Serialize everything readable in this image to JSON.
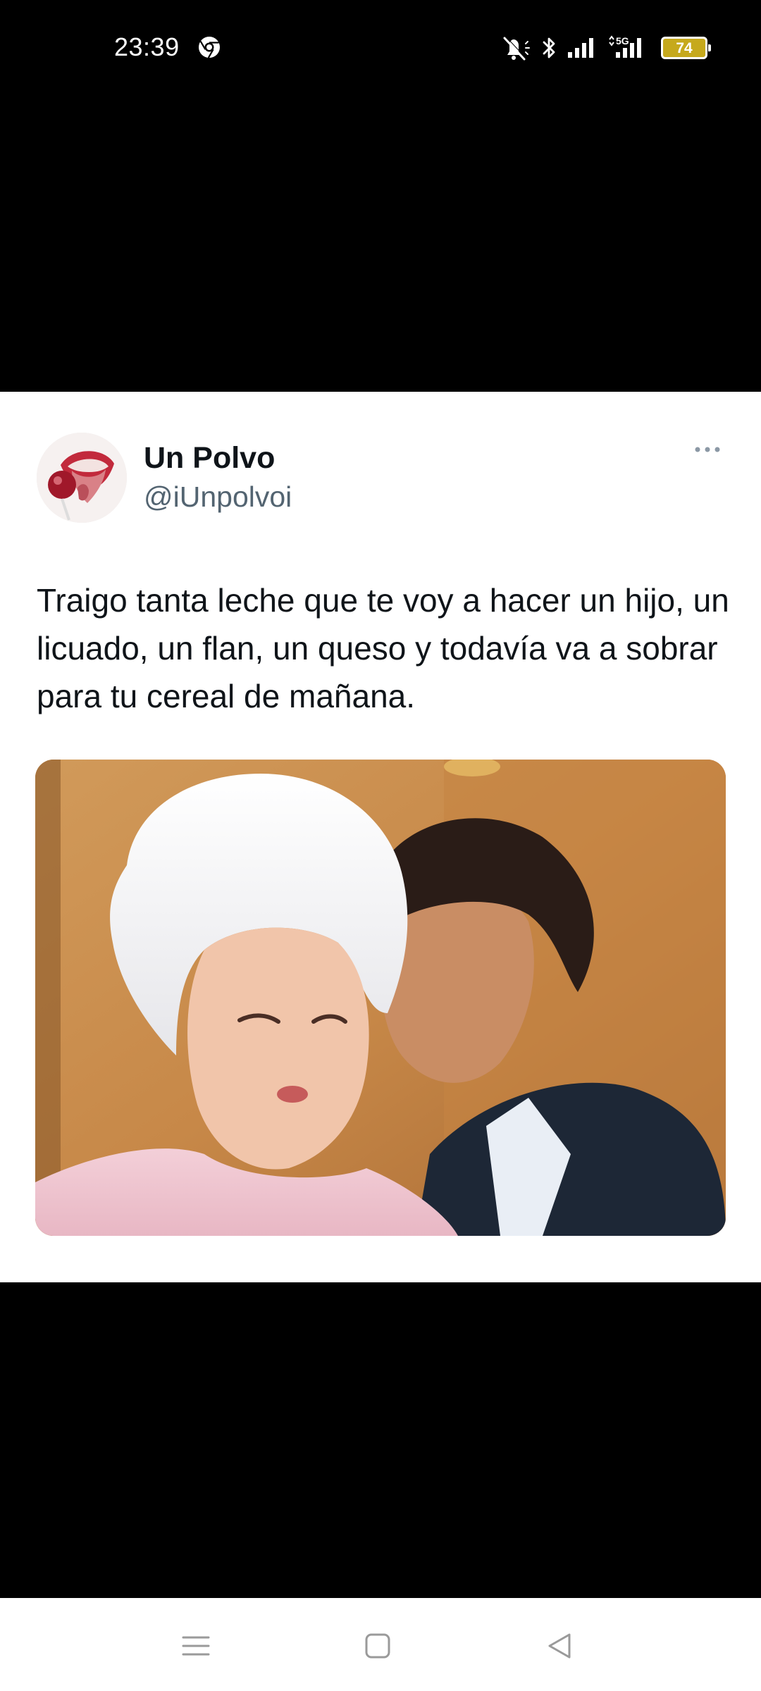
{
  "status_bar": {
    "time": "23:39",
    "battery_level": "74",
    "network_label": "5G",
    "icons": [
      "chrome-icon",
      "mute-icon",
      "bluetooth-icon",
      "signal-icon",
      "signal-5g-icon",
      "battery-icon"
    ]
  },
  "tweet": {
    "display_name": "Un Polvo",
    "handle": "@iUnpolvoi",
    "text": "Traigo tanta leche que te voy a hacer un hijo, un licuado, un flan, un queso y todavía va a sobrar para tu cereal de mañana.",
    "more_icon": "more-horizontal-icon"
  },
  "nav_bar": {
    "buttons": [
      "menu-icon",
      "home-square-icon",
      "back-triangle-icon"
    ]
  },
  "colors": {
    "background": "#000000",
    "card": "#ffffff",
    "name_text": "#0f1419",
    "secondary_text": "#536471",
    "battery_fill": "#c6a91c"
  }
}
